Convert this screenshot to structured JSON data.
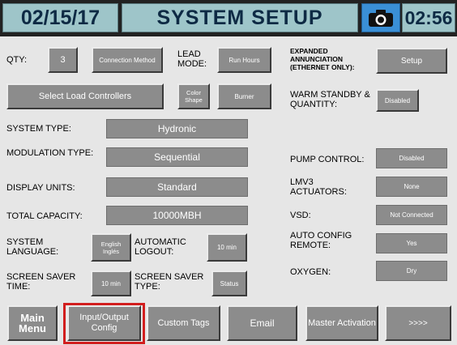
{
  "header": {
    "date": "02/15/17",
    "title": "SYSTEM SETUP",
    "camera_icon": "camera-icon",
    "time": "02:56"
  },
  "row1": {
    "qty_label": "QTY:",
    "qty_value": "3",
    "connection_method": "Connection Method",
    "lead_mode_label": "LEAD MODE:",
    "lead_mode_value": "Run Hours",
    "expanded_label": "EXPANDED ANNUNCIATION (ETHERNET ONLY):",
    "setup_button": "Setup"
  },
  "row2": {
    "select_load_controllers": "Select Load Controllers",
    "color_shape": "Color Shape",
    "burner": "Burner",
    "warm_standby_label": "WARM STANDBY & QUANTITY:",
    "warm_standby_value": "Disabled"
  },
  "settings": {
    "system_type_label": "SYSTEM TYPE:",
    "system_type_value": "Hydronic",
    "modulation_type_label": "MODULATION TYPE:",
    "modulation_type_value": "Sequential",
    "display_units_label": "DISPLAY UNITS:",
    "display_units_value": "Standard",
    "total_capacity_label": "TOTAL CAPACITY:",
    "total_capacity_value": "10000MBH",
    "system_language_label": "SYSTEM LANGUAGE:",
    "system_language_value": "English Inglés",
    "automatic_logout_label": "AUTOMATIC LOGOUT:",
    "automatic_logout_value": "10 min",
    "screen_saver_time_label": "SCREEN SAVER TIME:",
    "screen_saver_time_value": "10 min",
    "screen_saver_type_label": "SCREEN SAVER TYPE:",
    "screen_saver_type_value": "Status"
  },
  "right": {
    "pump_control_label": "PUMP CONTROL:",
    "pump_control_value": "Disabled",
    "lmv3_label": "LMV3 ACTUATORS:",
    "lmv3_value": "None",
    "vsd_label": "VSD:",
    "vsd_value": "Not Connected",
    "auto_config_label": "AUTO CONFIG REMOTE:",
    "auto_config_value": "Yes",
    "oxygen_label": "OXYGEN:",
    "oxygen_value": "Dry"
  },
  "nav": {
    "main_menu": "Main Menu",
    "input_output_config": "Input/Output Config",
    "custom_tags": "Custom Tags",
    "email": "Email",
    "master_activation": "Master Activation",
    "next": ">>>>"
  },
  "colors": {
    "header_bg": "#9ec5c9",
    "header_text": "#0e2a44",
    "camera": "#3a8fd6",
    "field": "#8c8c8c",
    "highlight": "#d21e1e"
  }
}
